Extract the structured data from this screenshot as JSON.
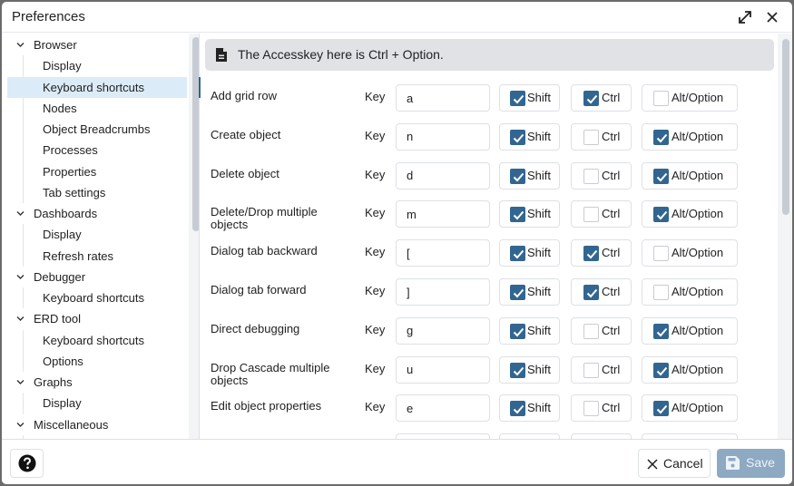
{
  "window": {
    "title": "Preferences"
  },
  "titlebar": {
    "expand_icon": "expand-arrows-icon",
    "close_icon": "close-x-icon"
  },
  "sidebar": {
    "items": [
      {
        "label": "Browser",
        "level": 0,
        "expanded": true
      },
      {
        "label": "Display",
        "level": 1
      },
      {
        "label": "Keyboard shortcuts",
        "level": 1,
        "selected": true
      },
      {
        "label": "Nodes",
        "level": 1
      },
      {
        "label": "Object Breadcrumbs",
        "level": 1
      },
      {
        "label": "Processes",
        "level": 1
      },
      {
        "label": "Properties",
        "level": 1
      },
      {
        "label": "Tab settings",
        "level": 1
      },
      {
        "label": "Dashboards",
        "level": 0,
        "expanded": true
      },
      {
        "label": "Display",
        "level": 1
      },
      {
        "label": "Refresh rates",
        "level": 1
      },
      {
        "label": "Debugger",
        "level": 0,
        "expanded": true
      },
      {
        "label": "Keyboard shortcuts",
        "level": 1
      },
      {
        "label": "ERD tool",
        "level": 0,
        "expanded": true
      },
      {
        "label": "Keyboard shortcuts",
        "level": 1
      },
      {
        "label": "Options",
        "level": 1
      },
      {
        "label": "Graphs",
        "level": 0,
        "expanded": true
      },
      {
        "label": "Display",
        "level": 1
      },
      {
        "label": "Miscellaneous",
        "level": 0,
        "expanded": true
      }
    ]
  },
  "main": {
    "notice": {
      "icon": "document-icon",
      "text": "The Accesskey here is Ctrl + Option."
    },
    "key_label": "Key",
    "modifier_labels": {
      "shift": "Shift",
      "ctrl": "Ctrl",
      "alt": "Alt/Option"
    },
    "shortcuts": [
      {
        "label": "Add grid row",
        "key": "a",
        "shift": true,
        "ctrl": true,
        "alt": false
      },
      {
        "label": "Create object",
        "key": "n",
        "shift": true,
        "ctrl": false,
        "alt": true
      },
      {
        "label": "Delete object",
        "key": "d",
        "shift": true,
        "ctrl": false,
        "alt": true
      },
      {
        "label": "Delete/Drop multiple objects",
        "key": "m",
        "shift": true,
        "ctrl": false,
        "alt": true
      },
      {
        "label": "Dialog tab backward",
        "key": "[",
        "shift": true,
        "ctrl": true,
        "alt": false
      },
      {
        "label": "Dialog tab forward",
        "key": "]",
        "shift": true,
        "ctrl": true,
        "alt": false
      },
      {
        "label": "Direct debugging",
        "key": "g",
        "shift": true,
        "ctrl": false,
        "alt": true
      },
      {
        "label": "Drop Cascade multiple objects",
        "key": "u",
        "shift": true,
        "ctrl": false,
        "alt": true
      },
      {
        "label": "Edit object properties",
        "key": "e",
        "shift": true,
        "ctrl": false,
        "alt": true
      }
    ]
  },
  "footer": {
    "help_icon": "help-circle-icon",
    "cancel_label": "Cancel",
    "save_label": "Save",
    "save_enabled": false
  },
  "colors": {
    "accent": "#326690",
    "selected_bg": "#dbebf7",
    "save_disabled": "#8ea9c2"
  }
}
